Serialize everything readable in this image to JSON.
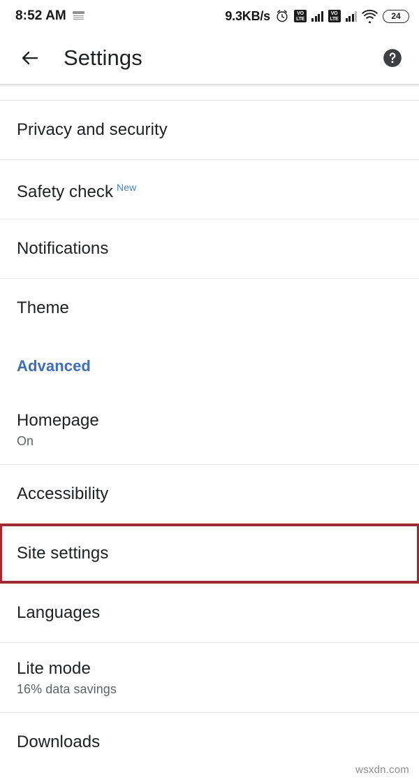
{
  "status_bar": {
    "clock": "8:52 AM",
    "sim_icon": "sim-card-icon",
    "network_speed": "9.3KB/s",
    "alarm_icon": "alarm-clock-icon",
    "volte_label_top": "VO",
    "volte_label_bottom": "LTE",
    "wifi_icon": "wifi-icon",
    "battery_level": "24"
  },
  "app_bar": {
    "back_icon": "back-arrow-icon",
    "title": "Settings",
    "help_icon": "help-circle-icon"
  },
  "settings": {
    "items": [
      {
        "title": "Privacy and security",
        "sub": null,
        "badge": null,
        "type": "row",
        "highlighted": false
      },
      {
        "title": "Safety check",
        "sub": null,
        "badge": "New",
        "type": "row",
        "highlighted": false
      },
      {
        "title": "Notifications",
        "sub": null,
        "badge": null,
        "type": "row",
        "highlighted": false
      },
      {
        "title": "Theme",
        "sub": null,
        "badge": null,
        "type": "row",
        "highlighted": false
      },
      {
        "title": "Advanced",
        "sub": null,
        "badge": null,
        "type": "section",
        "highlighted": false
      },
      {
        "title": "Homepage",
        "sub": "On",
        "badge": null,
        "type": "row",
        "highlighted": false
      },
      {
        "title": "Accessibility",
        "sub": null,
        "badge": null,
        "type": "row",
        "highlighted": false
      },
      {
        "title": "Site settings",
        "sub": null,
        "badge": null,
        "type": "row",
        "highlighted": true
      },
      {
        "title": "Languages",
        "sub": null,
        "badge": null,
        "type": "row",
        "highlighted": false
      },
      {
        "title": "Lite mode",
        "sub": "16% data savings",
        "badge": null,
        "type": "row",
        "highlighted": false
      },
      {
        "title": "Downloads",
        "sub": null,
        "badge": null,
        "type": "row",
        "highlighted": false
      }
    ]
  },
  "watermark": {
    "text": "wsxdn.com"
  },
  "colors": {
    "accent_blue": "#3d6fb4",
    "badge_blue": "#4285c4",
    "highlight_red": "#9e2a34",
    "text_primary": "#202124",
    "text_secondary": "#5f6368",
    "divider": "#e4e4e6"
  }
}
